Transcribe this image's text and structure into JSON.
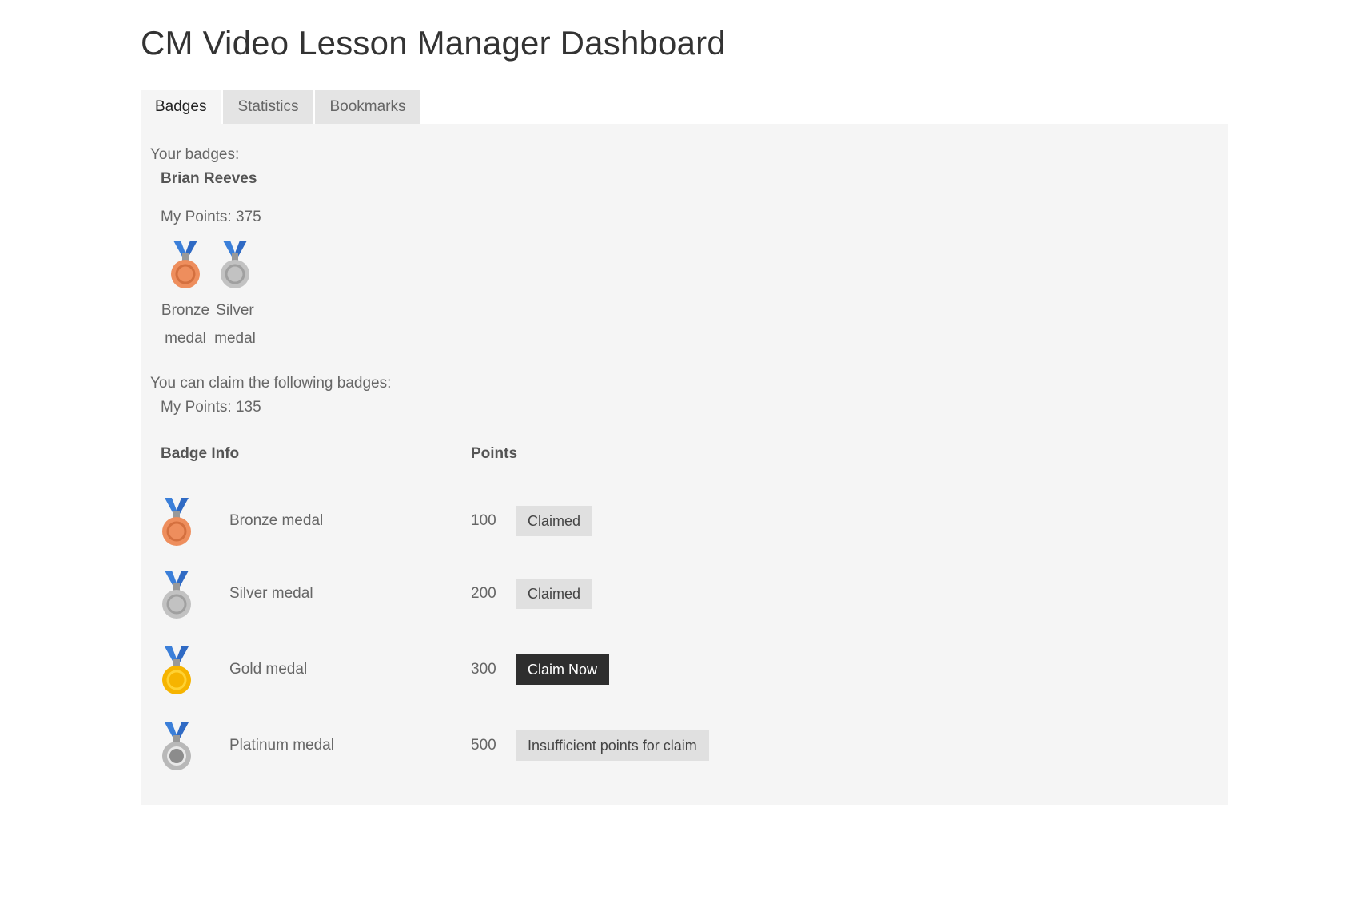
{
  "page": {
    "title": "CM Video Lesson Manager Dashboard"
  },
  "tabs": [
    {
      "label": "Badges",
      "active": true
    },
    {
      "label": "Statistics",
      "active": false
    },
    {
      "label": "Bookmarks",
      "active": false
    }
  ],
  "earned_section": {
    "heading": "Your badges:",
    "user_name": "Brian Reeves",
    "points_text": "My Points: 375",
    "badges": [
      {
        "line1": "Bronze",
        "line2": "medal",
        "icon": "bronze-medal-icon"
      },
      {
        "line1": "Silver",
        "line2": "medal",
        "icon": "silver-medal-icon"
      }
    ]
  },
  "claim_section": {
    "heading": "You can claim the following badges:",
    "points_text": "My Points: 135",
    "columns": {
      "info": "Badge Info",
      "points": "Points"
    },
    "rows": [
      {
        "name": "Bronze medal",
        "points": "100",
        "action": "Claimed",
        "icon": "bronze-medal-icon"
      },
      {
        "name": "Silver medal",
        "points": "200",
        "action": "Claimed",
        "icon": "silver-medal-icon"
      },
      {
        "name": "Gold medal",
        "points": "300",
        "action": "Claim Now",
        "icon": "gold-medal-icon"
      },
      {
        "name": "Platinum medal",
        "points": "500",
        "action": "Insufficient points for claim",
        "icon": "platinum-medal-icon"
      }
    ]
  },
  "colors": {
    "ribbon": "#3b7fd9",
    "bronze": "#ee8e5d",
    "silver": "#c2c2c2",
    "gold": "#f6b400",
    "platinum": "#b8b8b8",
    "claim_now_bg": "#2e2e2e",
    "button_bg": "#e0e0e0",
    "panel_bg": "#f5f5f5"
  }
}
